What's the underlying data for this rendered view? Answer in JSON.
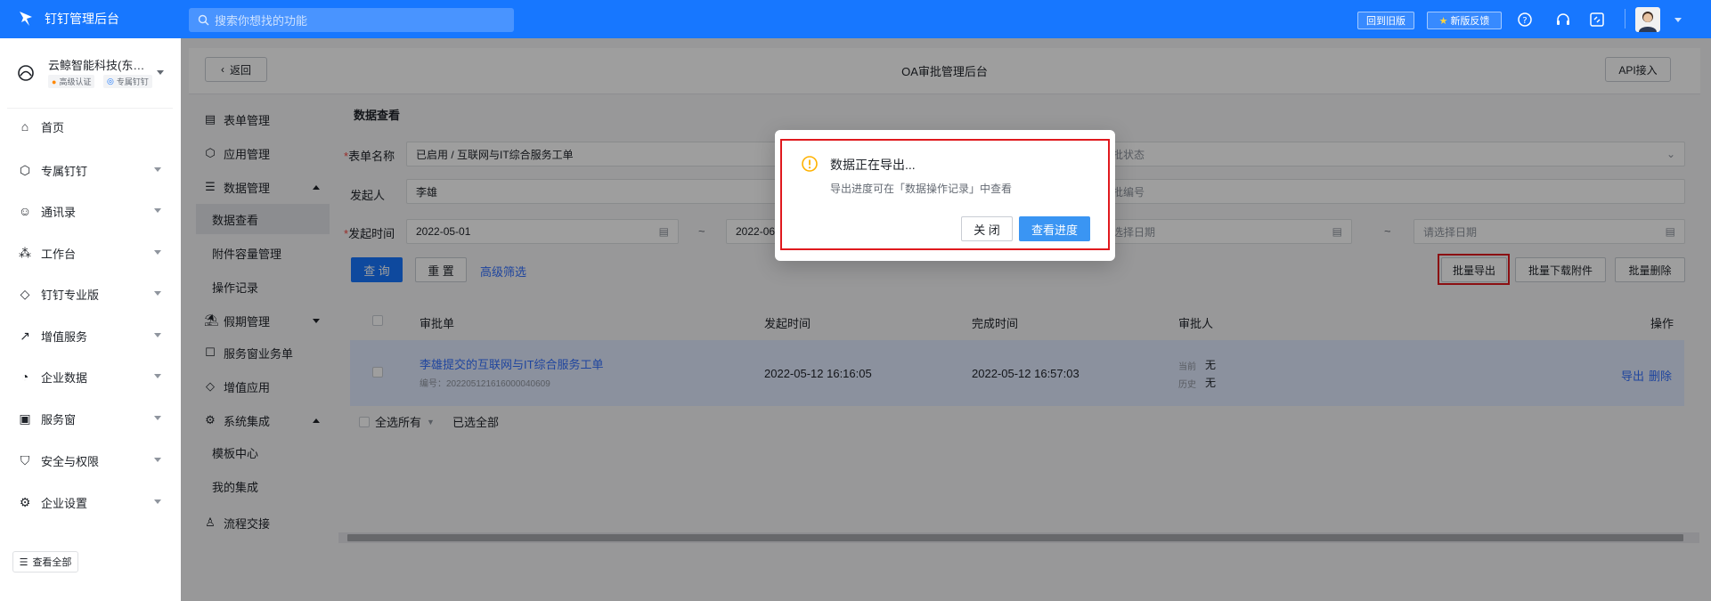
{
  "topbar": {
    "brand": "钉钉管理后台",
    "search_placeholder": "搜索你想找的功能",
    "btn_old": "回到旧版",
    "btn_feedback": "新版反馈"
  },
  "sidebar": {
    "org_name": "云鲸智能科技(东莞…",
    "badge1": "高级认证",
    "badge2": "专属钉钉",
    "items": [
      {
        "label": "首页",
        "icon": "home-icon",
        "chev": false
      },
      {
        "label": "专属钉钉",
        "icon": "shield-hex-icon",
        "chev": true
      },
      {
        "label": "通讯录",
        "icon": "contacts-icon",
        "chev": true
      },
      {
        "label": "工作台",
        "icon": "grid-icon",
        "chev": true
      },
      {
        "label": "钉钉专业版",
        "icon": "diamond-icon",
        "chev": true
      },
      {
        "label": "增值服务",
        "icon": "trend-icon",
        "chev": true
      },
      {
        "label": "企业数据",
        "icon": "pie-icon",
        "chev": true
      },
      {
        "label": "服务窗",
        "icon": "window-icon",
        "chev": true
      },
      {
        "label": "安全与权限",
        "icon": "shield-check-icon",
        "chev": true
      },
      {
        "label": "企业设置",
        "icon": "settings-icon",
        "chev": true
      }
    ],
    "view_all": "查看全部"
  },
  "header": {
    "back": "返回",
    "title": "OA审批管理后台",
    "api": "API接入"
  },
  "inner_nav": [
    {
      "label": "表单管理",
      "icon": "form-icon",
      "sub": false
    },
    {
      "label": "应用管理",
      "icon": "cube-icon",
      "sub": false
    },
    {
      "label": "数据管理",
      "icon": "database-icon",
      "sub": false,
      "chev": "up"
    },
    {
      "label": "数据查看",
      "sub": true,
      "active": true
    },
    {
      "label": "附件容量管理",
      "sub": true
    },
    {
      "label": "操作记录",
      "sub": true
    },
    {
      "label": "假期管理",
      "icon": "holiday-icon",
      "sub": false,
      "chev": "down"
    },
    {
      "label": "服务窗业务单",
      "icon": "chat-icon",
      "sub": false
    },
    {
      "label": "增值应用",
      "icon": "diamond-icon",
      "sub": false
    },
    {
      "label": "系统集成",
      "icon": "gear-icon",
      "sub": false,
      "chev": "up"
    },
    {
      "label": "模板中心",
      "sub": true
    },
    {
      "label": "我的集成",
      "sub": true
    },
    {
      "label": "流程交接",
      "icon": "user-icon",
      "sub": false
    }
  ],
  "main": {
    "section_title": "数据查看",
    "form_name_label": "表单名称",
    "form_name_value": "已启用 / 互联网与IT综合服务工单",
    "initiator_label": "发起人",
    "initiator_value": "李雄",
    "start_time_label": "发起时间",
    "start_date_from": "2022-05-01",
    "start_date_to": "2022-06",
    "status_placeholder": "批状态",
    "number_placeholder": "批编号",
    "date_placeholder_a": "选择日期",
    "date_placeholder_b": "请选择日期",
    "tilde": "~",
    "query": "查 询",
    "reset": "重 置",
    "advanced": "高级筛选",
    "batch_export": "批量导出",
    "batch_download": "批量下载附件",
    "batch_delete": "批量删除"
  },
  "table": {
    "headers": [
      "审批单",
      "发起时间",
      "完成时间",
      "审批人",
      "操作"
    ],
    "row": {
      "title": "李雄提交的互联网与IT综合服务工单",
      "number": "编号：202205121616000040609",
      "start_time": "2022-05-12 16:16:05",
      "end_time": "2022-05-12 16:57:03",
      "current_label": "当前",
      "current_value": "无",
      "history_label": "历史",
      "history_value": "无",
      "action_export": "导出",
      "action_delete": "删除"
    },
    "footer_select_all": "全选所有",
    "footer_selected_all": "已选全部"
  },
  "dialog": {
    "title": "数据正在导出...",
    "message": "导出进度可在「数据操作记录」中查看",
    "close": "关 闭",
    "view_progress": "查看进度"
  },
  "colors": {
    "primary": "#1777ff",
    "link": "#3370ff",
    "highlight": "#e0191e",
    "warn": "#ffb200",
    "selected_row": "#e1eaff"
  }
}
